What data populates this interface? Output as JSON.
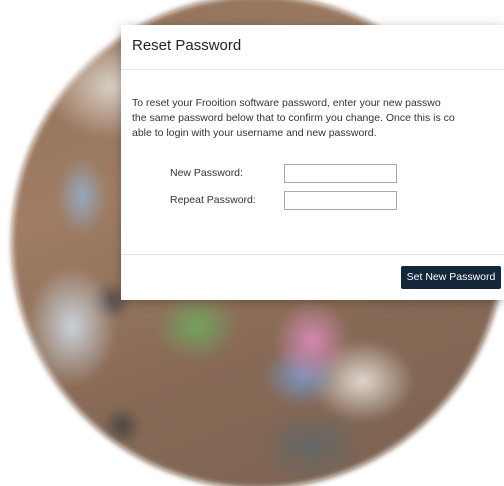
{
  "dialog": {
    "title": "Reset Password",
    "instructions": [
      "To reset your Frooition software password, enter your new passwo",
      "the same password below that to confirm you change. Once this is co",
      "able to login with your username and new password."
    ],
    "fields": [
      {
        "label": "New Password:",
        "value": "",
        "placeholder": ""
      },
      {
        "label": "Repeat Password:",
        "value": "",
        "placeholder": ""
      }
    ],
    "submit_label": "Set New Password"
  },
  "colors": {
    "button_bg": "#14263a",
    "button_text": "#ffffff",
    "modal_bg": "#ffffff"
  }
}
